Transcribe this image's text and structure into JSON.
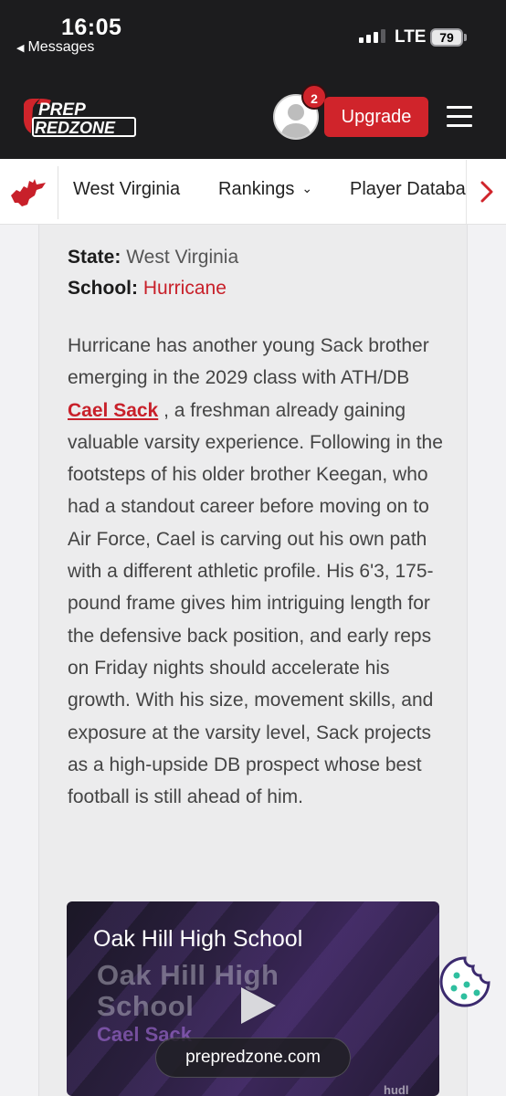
{
  "status_bar": {
    "time": "16:05",
    "back_label": "Messages",
    "network": "LTE",
    "battery": "79"
  },
  "header": {
    "logo_line1": "PREP",
    "logo_line2": "REDZONE",
    "notification_count": "2",
    "upgrade_label": "Upgrade"
  },
  "nav": {
    "items": [
      {
        "label": "West Virginia"
      },
      {
        "label": "Rankings"
      },
      {
        "label": "Player Database"
      }
    ]
  },
  "article": {
    "state_label": "State:",
    "state_value": "West Virginia",
    "school_label": "School:",
    "school_value": "Hurricane",
    "body_before_link": "Hurricane has another young Sack brother emerging in the 2029 class with ATH/DB ",
    "player_link": "Cael Sack",
    "body_after_link": " , a freshman already gaining valuable varsity experience. Following in the footsteps of his older brother Keegan, who had a standout career before moving on to Air Force, Cael is carving out his own path with a different athletic profile. His 6'3, 175-pound frame gives him intriguing length for the defensive back position, and early reps on Friday nights should accelerate his growth. With his size, movement skills, and exposure at the varsity level, Sack projects as a high-upside DB prospect whose best football is still ahead of him."
  },
  "video": {
    "title": "Oak Hill High School",
    "overlay_line1": "Oak Hill High",
    "overlay_line2": "School",
    "overlay_name": "Cael Sack",
    "domain": "prepredzone.com",
    "watermark": "hudl"
  },
  "colors": {
    "brand_red": "#d0242b",
    "header_bg": "#1c1c1e",
    "link_red": "#c8202a"
  }
}
